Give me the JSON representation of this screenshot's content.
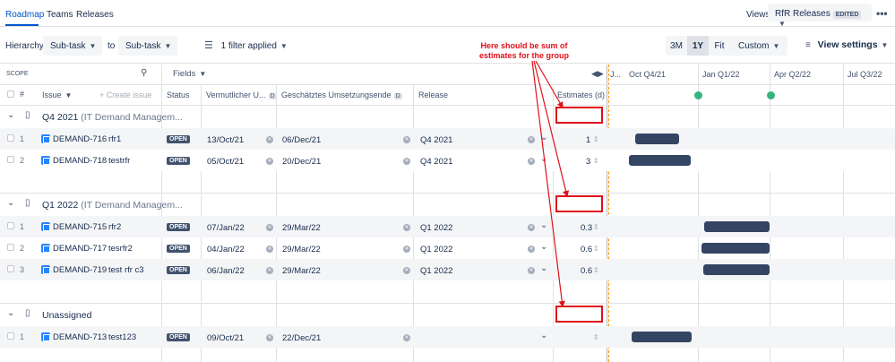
{
  "tabs": [
    {
      "label": "Roadmap"
    },
    {
      "label": "Teams"
    },
    {
      "label": "Releases"
    }
  ],
  "views": {
    "label": "Views:",
    "selected": "RfR Releases",
    "badge": "EDITED"
  },
  "toolbar": {
    "hierarchy_label": "Hierarchy:",
    "from": "Sub-task",
    "to_label": "to",
    "to": "Sub-task",
    "filter_label": "1 filter applied",
    "zoom": [
      "3M",
      "1Y",
      "Fit",
      "Custom"
    ],
    "zoom_selected": "1Y",
    "view_settings": "View settings"
  },
  "table": {
    "scope_label": "SCOPE",
    "fields_label": "Fields",
    "headers": {
      "hash": "#",
      "issue": "Issue",
      "create_issue": "+ Create issue",
      "status": "Status",
      "start": "Vermutlicher U...",
      "end": "Geschätztes Umsetzungsende",
      "release": "Release",
      "estimates": "Estimates (d)"
    },
    "d_badge": "D"
  },
  "timeline": {
    "labels": [
      "J...",
      "Oct Q4/21",
      "Jan Q1/22",
      "Apr Q2/22",
      "Jul Q3/22"
    ]
  },
  "groups": [
    {
      "title": "Q4 2021",
      "subtitle": "(IT Demand Managem...",
      "rows": [
        {
          "num": "1",
          "key": "DEMAND-716",
          "summary": "rfr1",
          "status": "OPEN",
          "start": "13/Oct/21",
          "end": "06/Dec/21",
          "release": "Q4 2021",
          "estimate": "1"
        },
        {
          "num": "2",
          "key": "DEMAND-718",
          "summary": "testrfr",
          "status": "OPEN",
          "start": "05/Oct/21",
          "end": "20/Dec/21",
          "release": "Q4 2021",
          "estimate": "3"
        }
      ]
    },
    {
      "title": "Q1 2022",
      "subtitle": "(IT Demand Managem...",
      "rows": [
        {
          "num": "1",
          "key": "DEMAND-715",
          "summary": "rfr2",
          "status": "OPEN",
          "start": "07/Jan/22",
          "end": "29/Mar/22",
          "release": "Q1 2022",
          "estimate": "0.3"
        },
        {
          "num": "2",
          "key": "DEMAND-717",
          "summary": "tesrfr2",
          "status": "OPEN",
          "start": "04/Jan/22",
          "end": "29/Mar/22",
          "release": "Q1 2022",
          "estimate": "0.6"
        },
        {
          "num": "3",
          "key": "DEMAND-719",
          "summary": "test rfr c3",
          "status": "OPEN",
          "start": "06/Jan/22",
          "end": "29/Mar/22",
          "release": "Q1 2022",
          "estimate": "0.6"
        }
      ]
    },
    {
      "title": "Unassigned",
      "subtitle": "",
      "rows": [
        {
          "num": "1",
          "key": "DEMAND-713",
          "summary": "test123",
          "status": "OPEN",
          "start": "09/Oct/21",
          "end": "22/Dec/21",
          "release": "",
          "estimate": ""
        }
      ]
    }
  ],
  "annotation": {
    "text_line1": "Here should be sum of",
    "text_line2": "estimates for the group",
    "color": "#e0101a"
  },
  "colors": {
    "accent": "#0052cc",
    "bar": "#344563",
    "release_dot": "#36b37e"
  }
}
